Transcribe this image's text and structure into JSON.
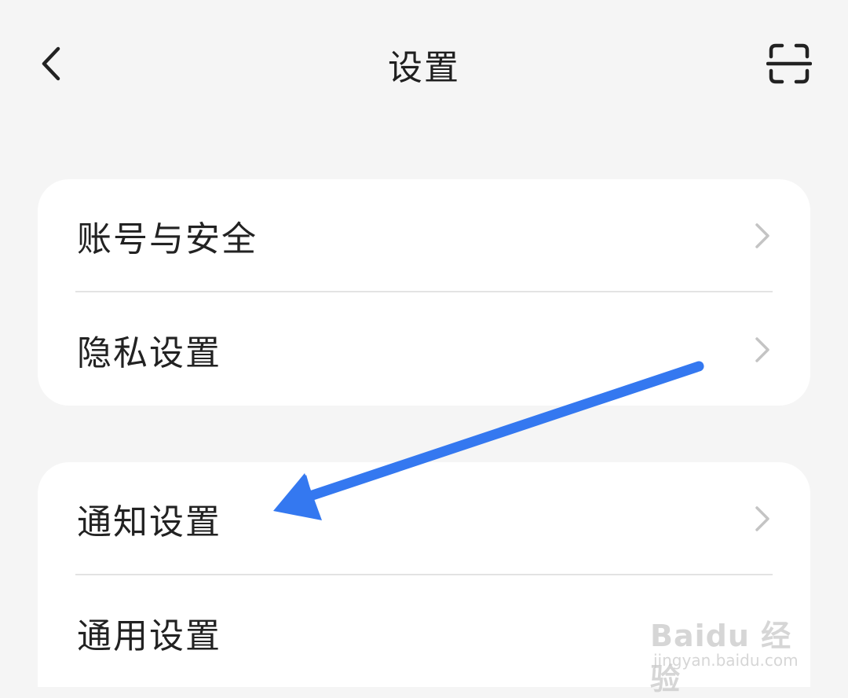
{
  "header": {
    "title": "设置",
    "back_icon": "chevron-left-icon",
    "scan_icon": "scan-icon"
  },
  "settings_groups": [
    {
      "items": [
        {
          "label": "账号与安全",
          "icon": "chevron-right-icon"
        },
        {
          "label": "隐私设置",
          "icon": "chevron-right-icon"
        }
      ]
    },
    {
      "items": [
        {
          "label": "通知设置",
          "icon": "chevron-right-icon"
        },
        {
          "label": "通用设置",
          "icon": "chevron-right-icon"
        }
      ]
    }
  ],
  "annotation": {
    "color": "#3478f0",
    "points_to": "通知设置"
  },
  "watermark": {
    "logo": "Baidu 经验",
    "url": "jingyan.baidu.com"
  },
  "colors": {
    "background": "#f5f5f5",
    "card": "#ffffff",
    "text": "#222222",
    "chevron": "#c4c4c4",
    "divider": "#e3e3e3"
  }
}
